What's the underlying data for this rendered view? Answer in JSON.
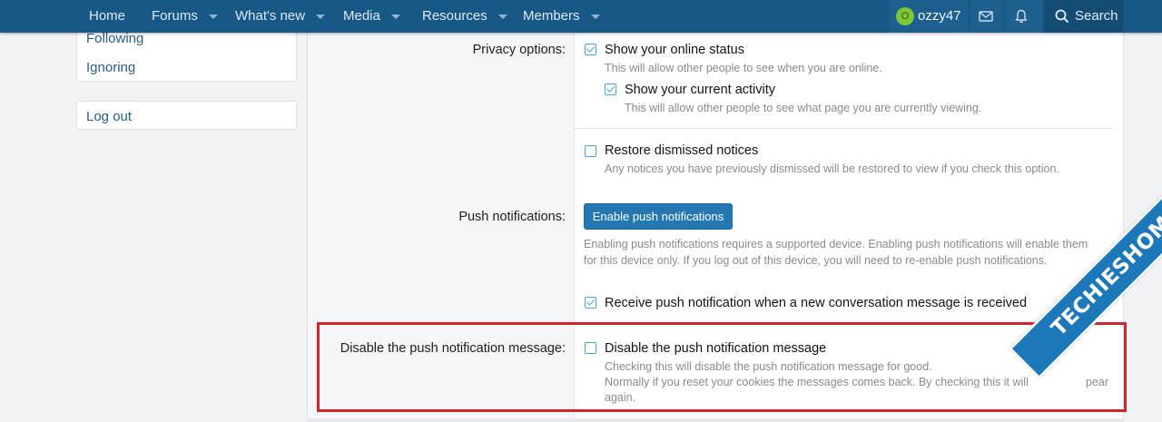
{
  "nav": {
    "items": [
      {
        "label": "Home",
        "has_dropdown": false
      },
      {
        "label": "Forums",
        "has_dropdown": true
      },
      {
        "label": "What's new",
        "has_dropdown": true
      },
      {
        "label": "Media",
        "has_dropdown": true
      },
      {
        "label": "Resources",
        "has_dropdown": true
      },
      {
        "label": "Members",
        "has_dropdown": true
      }
    ],
    "user": {
      "avatar_letter": "O",
      "username": "ozzy47"
    },
    "search_label": "Search",
    "icons": [
      "envelope-icon",
      "bell-icon",
      "search-icon"
    ]
  },
  "sidebar": {
    "links": [
      "Following",
      "Ignoring"
    ],
    "logout": "Log out"
  },
  "form": {
    "privacy_label": "Privacy options:",
    "online_status": {
      "label": "Show your online status",
      "hint": "This will allow other people to see when you are online.",
      "checked": true
    },
    "current_activity": {
      "label": "Show your current activity",
      "hint": "This will allow other people to see what page you are currently viewing.",
      "checked": true
    },
    "restore_notices": {
      "label": "Restore dismissed notices",
      "hint": "Any notices you have previously dismissed will be restored to view if you check this option.",
      "checked": false
    },
    "push_label": "Push notifications:",
    "push_button": "Enable push notifications",
    "push_hint_1": "Enabling push notifications requires a supported device. Enabling push notifications will enable them",
    "push_hint_2": "for this device only. If you log out of this device, you will need to re-enable push notifications.",
    "receive_push": {
      "label": "Receive push notification when a new conversation message is received",
      "checked": true
    },
    "disable_label": "Disable the push notification message:",
    "disable_push": {
      "label": "Disable the push notification message",
      "hint_1": "Checking this will disable the push notification message for good.",
      "hint_2": "Normally if you reset your cookies the messages comes back. By checking this it will",
      "hint_2_end": "pear",
      "hint_3": "again.",
      "checked": false
    }
  },
  "watermark": "TECHIESHOME.COM",
  "colors": {
    "nav_bg": "#185886",
    "button_bg": "#2577b1",
    "checkbox": "#47a7c7",
    "highlight": "#d1242f",
    "link": "#2b5d86"
  }
}
